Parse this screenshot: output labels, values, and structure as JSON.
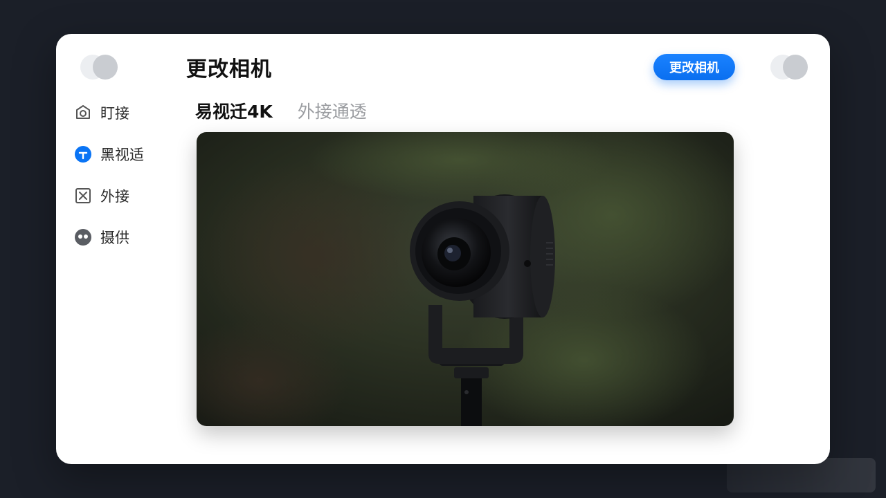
{
  "window": {
    "title": "更改相机",
    "primary_button_label": "更改相机"
  },
  "sidebar": {
    "items": [
      {
        "label": "盯接",
        "icon": "camera-ring-icon"
      },
      {
        "label": "黑视适",
        "icon": "plus-circle-icon",
        "selected": true
      },
      {
        "label": "外接",
        "icon": "x-box-icon"
      },
      {
        "label": "摄供",
        "icon": "webcam-face-icon"
      }
    ]
  },
  "tabs": [
    {
      "label": "易视迁4K",
      "active": true
    },
    {
      "label": "外接通透",
      "active": false
    }
  ],
  "preview": {
    "icon": "camera-preview-image"
  },
  "colors": {
    "accent": "#0a74f5",
    "background": "#1b1f28",
    "panel": "#ffffff"
  }
}
